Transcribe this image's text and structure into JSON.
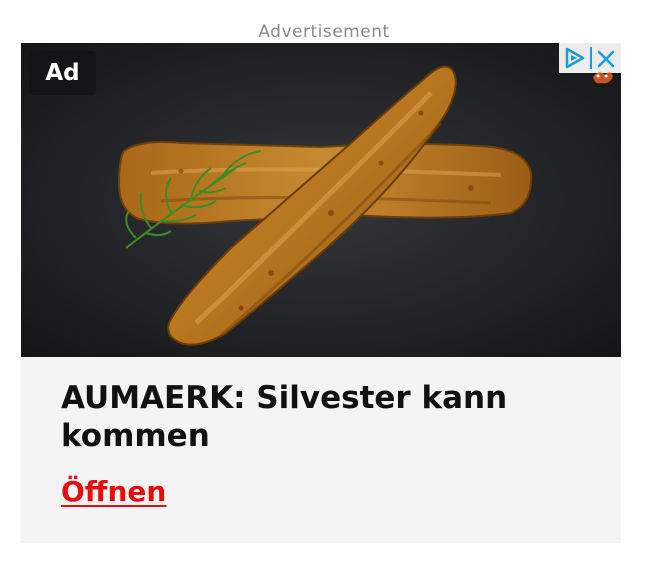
{
  "ad_disclosure": "Advertisement",
  "ad": {
    "badge": "Ad",
    "image_alt": "fried breaded fish fillets with dill",
    "title": "AUMAERK: Silvester kann kommen",
    "cta": "Öffnen",
    "adchoices_icon": "adchoices-icon",
    "close_icon": "close-icon"
  },
  "colors": {
    "cta": "#e50d0d",
    "card_bg": "#f4f4f4",
    "image_bg": "#232427",
    "adchoices_blue": "#1a9cd6"
  }
}
